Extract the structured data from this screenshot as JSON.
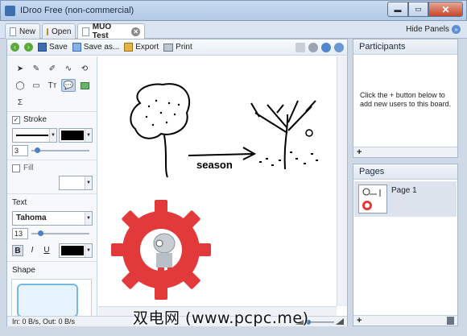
{
  "window": {
    "title": "IDroo Free (non-commercial)"
  },
  "tabs": {
    "new_label": "New",
    "open_label": "Open",
    "doc_label": "MUO Test",
    "hide_panels_label": "Hide Panels"
  },
  "toolbar": {
    "save_label": "Save",
    "saveas_label": "Save as...",
    "export_label": "Export",
    "print_label": "Print"
  },
  "tools_panel": {
    "stroke_label": "Stroke",
    "stroke_width": "3",
    "fill_label": "Fill",
    "text_label": "Text",
    "font_name": "Tahoma",
    "font_size": "13",
    "bold_label": "B",
    "italic_label": "I",
    "underline_label": "U",
    "shape_label": "Shape",
    "stroke_checked": true,
    "fill_checked": false,
    "stroke_color": "#000000",
    "text_color": "#000000"
  },
  "canvas": {
    "annotation": "season"
  },
  "status": {
    "traffic": "In: 0 B/s, Out: 0 B/s"
  },
  "participants": {
    "title": "Participants",
    "hint": "Click the + button below to add new users to this board."
  },
  "pages": {
    "title": "Pages",
    "items": [
      {
        "label": "Page 1"
      }
    ]
  },
  "watermark": "双电网 (www.pcpc.me)",
  "colors": {
    "accent": "#3d6fb0",
    "gear": "#e03b3b"
  }
}
